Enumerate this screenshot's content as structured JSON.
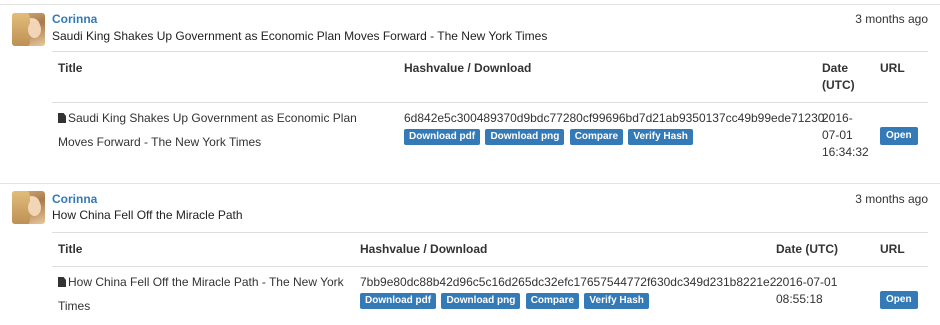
{
  "entries": [
    {
      "user": "Corinna",
      "ago": "3 months ago",
      "headline": "Saudi King Shakes Up Government as Economic Plan Moves Forward - The New York Times",
      "columns": {
        "title": "Title",
        "hash": "Hashvalue / Download",
        "date": "Date (UTC)",
        "url": "URL"
      },
      "row": {
        "title": "Saudi King Shakes Up Government as Economic Plan Moves Forward - The New York Times",
        "hash": "6d842e5c300489370d9bdc77280cf99696bd7d21ab9350137cc49b99ede71230",
        "date": "2016-07-01 16:34:32",
        "buttons": {
          "pdf": "Download pdf",
          "png": "Download png",
          "compare": "Compare",
          "verify": "Verify Hash"
        },
        "open": "Open"
      }
    },
    {
      "user": "Corinna",
      "ago": "3 months ago",
      "headline": "How China Fell Off the Miracle Path",
      "columns": {
        "title": "Title",
        "hash": "Hashvalue / Download",
        "date": "Date (UTC)",
        "url": "URL"
      },
      "row": {
        "title": "How China Fell Off the Miracle Path - The New York Times",
        "hash": "7bb9e80dc88b42d96c5c16d265dc32efc17657544772f630dc349d231b8221e2",
        "date": "2016-07-01 08:55:18",
        "buttons": {
          "pdf": "Download pdf",
          "png": "Download png",
          "compare": "Compare",
          "verify": "Verify Hash"
        },
        "open": "Open"
      }
    }
  ]
}
